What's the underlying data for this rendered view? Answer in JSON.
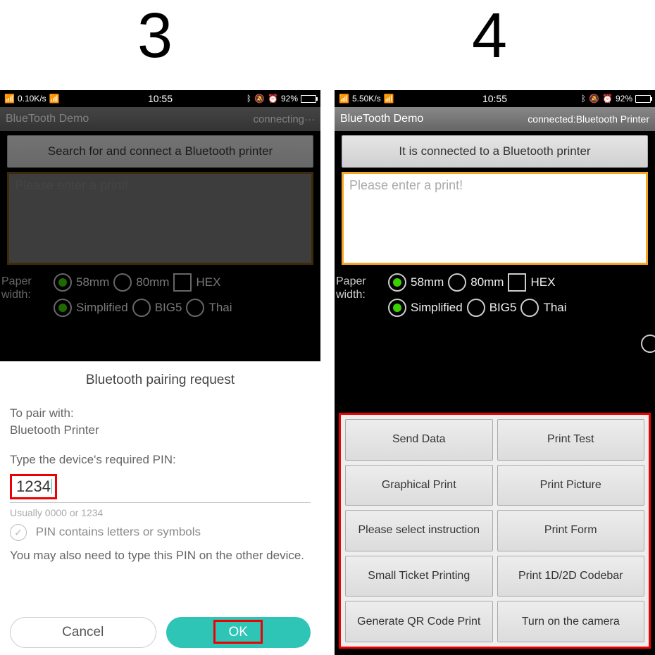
{
  "steps": {
    "s3": "3",
    "s4": "4"
  },
  "status": {
    "time": "10:55",
    "battery_pct": "92%",
    "p3_speed": "0.10K/s",
    "p4_speed": "5.50K/s"
  },
  "app_title": "BlueTooth Demo",
  "p3_app_status": "connecting···",
  "p4_app_status": "connected:Bluetooth Printer",
  "p3_search_btn": "Search for and connect a Bluetooth printer",
  "p4_search_btn": "It is connected to a Bluetooth printer",
  "textarea_placeholder": "Please enter a print!",
  "labels": {
    "paper_width": "Paper width:",
    "w58": "58mm",
    "w80": "80mm",
    "hex": "HEX",
    "simplified": "Simplified",
    "big5": "BIG5",
    "thai": "Thai"
  },
  "dialog": {
    "title": "Bluetooth pairing request",
    "to_pair": "To pair with:",
    "device": "Bluetooth Printer",
    "type_pin": "Type the device's required PIN:",
    "pin": "1234",
    "hint": "Usually 0000 or 1234",
    "checkbox": "PIN contains letters or symbols",
    "note": "You may also need to type this PIN on the other device.",
    "cancel": "Cancel",
    "ok": "OK"
  },
  "buttons": [
    [
      "Send Data",
      "Print Test"
    ],
    [
      "Graphical Print",
      "Print Picture"
    ],
    [
      "Please select instruction",
      "Print Form"
    ],
    [
      "Small Ticket Printing",
      "Print 1D/2D Codebar"
    ],
    [
      "Generate QR Code Print",
      "Turn on the camera"
    ]
  ]
}
